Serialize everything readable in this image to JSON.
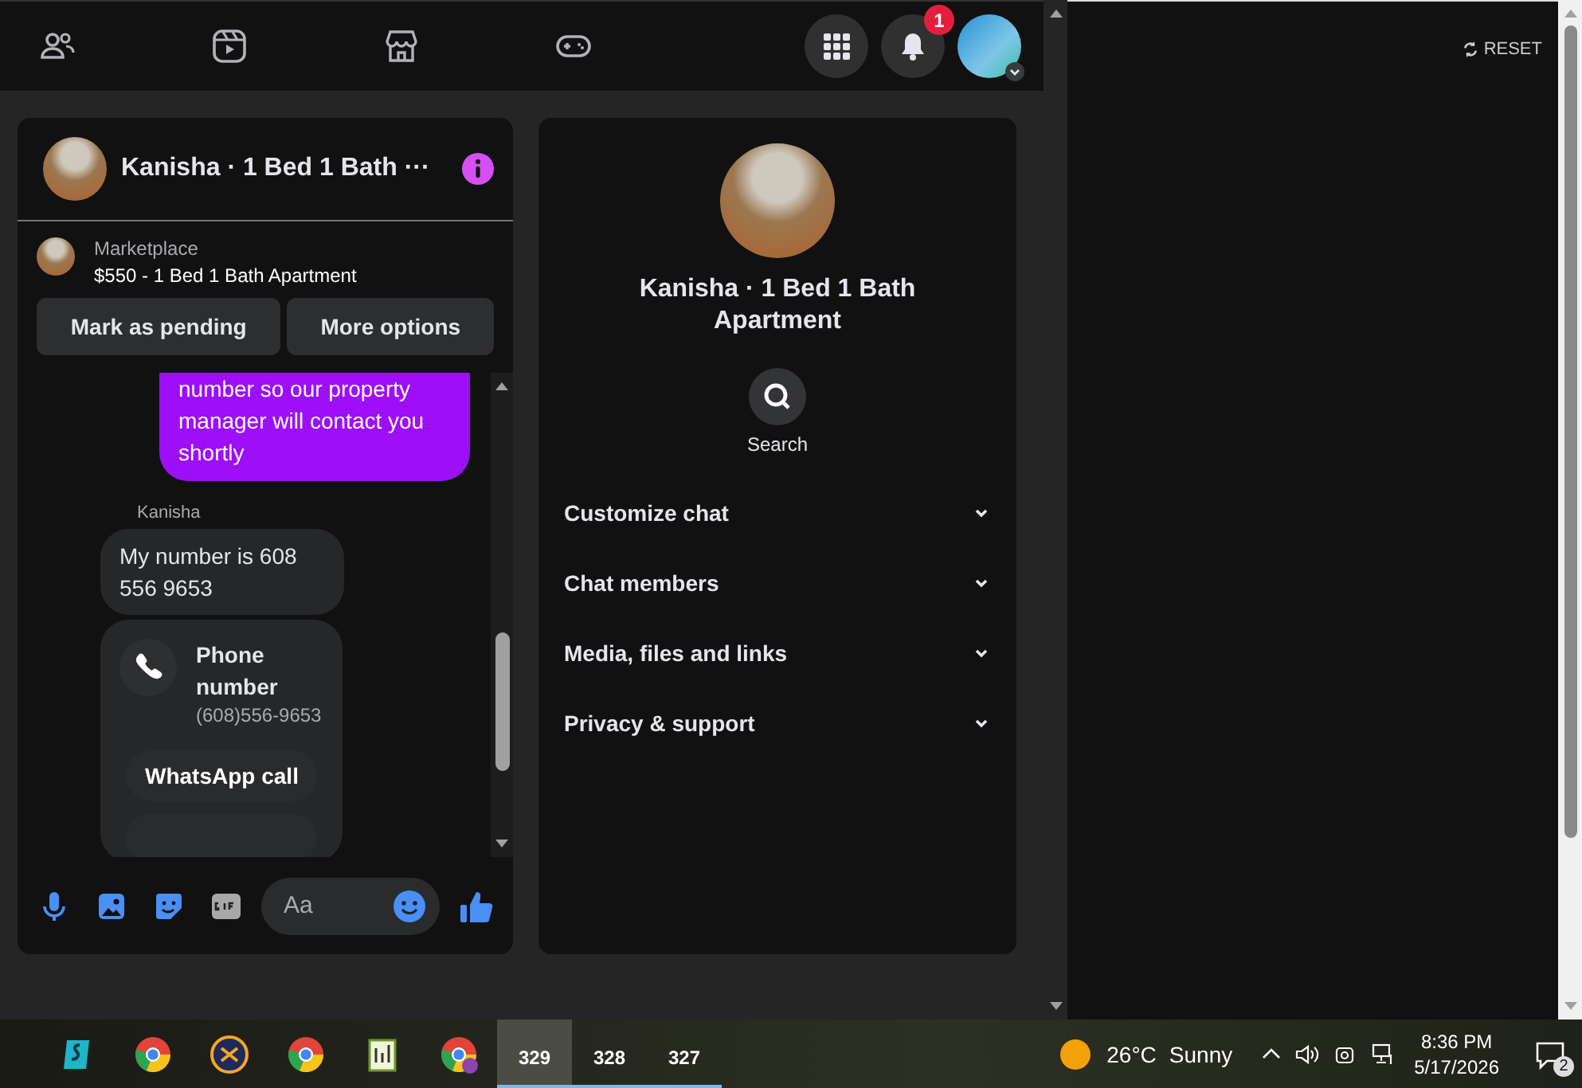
{
  "nav": {
    "notification_count": "1"
  },
  "chat": {
    "title": "Kanisha · 1 Bed 1 Bath ···",
    "listing": {
      "source": "Marketplace",
      "title": "$550 - 1 Bed 1 Bath Apartment"
    },
    "actions": [
      "Mark as pending",
      "More options"
    ],
    "messages": [
      {
        "kind": "outgoing",
        "text": "number so our property manager will contact you shortly"
      },
      {
        "kind": "sender",
        "text": "Kanisha"
      },
      {
        "kind": "incoming",
        "text": "My number is 608 556 9653"
      },
      {
        "kind": "contact_card",
        "title": "Phone number",
        "detail": "(608)556-9653",
        "action": "WhatsApp call"
      }
    ],
    "composer": {
      "placeholder": "Aa"
    }
  },
  "details": {
    "title": "Kanisha · 1 Bed 1 Bath Apartment",
    "search": "Search",
    "sections": [
      {
        "label": "Customize chat",
        "expanded": false
      },
      {
        "label": "Chat members",
        "expanded": false
      },
      {
        "label": "Media, files and links",
        "expanded": false
      },
      {
        "label": "Privacy & support",
        "expanded": false
      }
    ]
  },
  "reset": "RESET",
  "taskbar": {
    "apps": [
      {
        "label": "329",
        "active": true
      },
      {
        "label": "328",
        "active": false
      },
      {
        "label": "327",
        "active": false
      }
    ],
    "weather": {
      "temperature": "26°C",
      "condition": "Sunny"
    },
    "time": "8:36 PM",
    "date": "5/17/2026",
    "notifications": "2"
  }
}
